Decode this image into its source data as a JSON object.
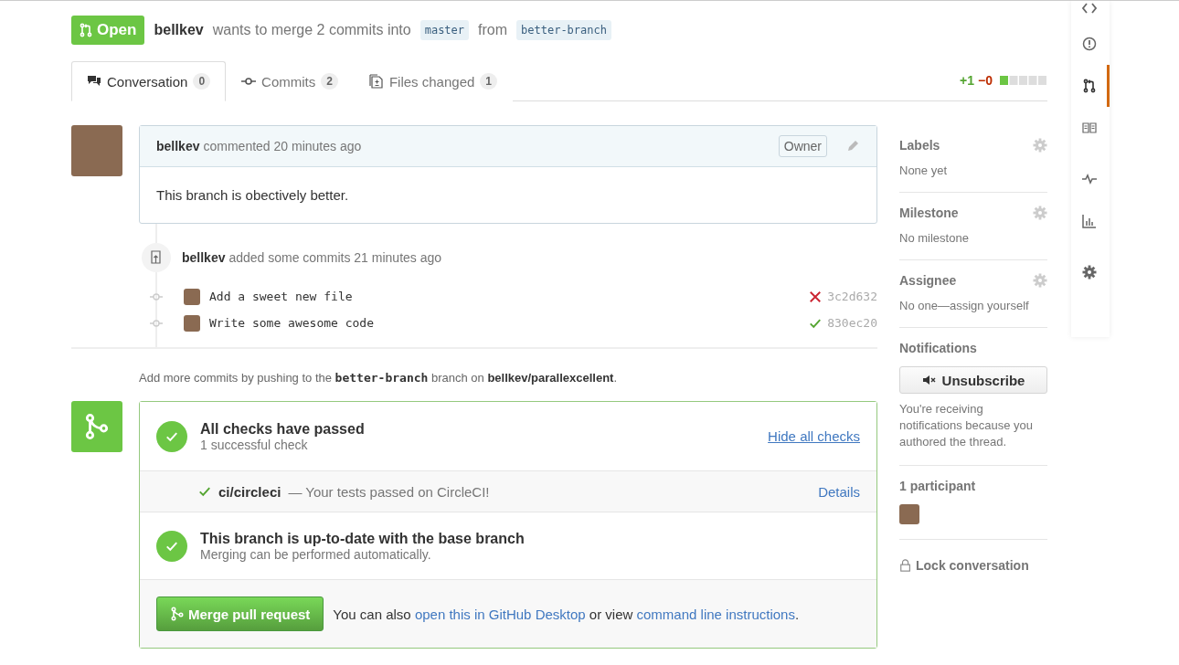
{
  "pr": {
    "state": "Open",
    "author": "bellkev",
    "text": "wants to merge 2 commits into",
    "base": "master",
    "joiner": "from",
    "head": "better-branch"
  },
  "tabs": [
    {
      "kind": "conversation",
      "label": "Conversation",
      "count": "0",
      "selected": true
    },
    {
      "kind": "commits",
      "label": "Commits",
      "count": "2",
      "selected": false
    },
    {
      "kind": "files",
      "label": "Files changed",
      "count": "1",
      "selected": false
    }
  ],
  "diffstat": {
    "added": "+1",
    "removed": "−0"
  },
  "comment": {
    "author": "bellkev",
    "action": "commented 20 minutes ago",
    "role": "Owner",
    "body": "This branch is obectively better."
  },
  "commit_event": {
    "author": "bellkev",
    "action": "added some commits 21 minutes ago",
    "commits": [
      {
        "message": "Add a sweet new file",
        "sha": "3c2d632",
        "passed": false
      },
      {
        "message": "Write some awesome code",
        "sha": "830ec20",
        "passed": true
      }
    ]
  },
  "hint": "Add more commits by pushing to the **better-branch** branch on **bellkev/parallexcellent**.",
  "merge": {
    "checks_title": "All checks have passed",
    "checks_subtitle": "1 successful check",
    "toggle_link": "Hide all checks",
    "checks": [
      {
        "name": "ci/circleci",
        "description": "— Your tests passed on CircleCI!",
        "link": "Details",
        "passed": true
      }
    ],
    "branch_title": "This branch is up-to-date with the base branch",
    "branch_subtitle": "Merging can be performed automatically.",
    "button": "Merge pull request",
    "also": [
      "You can also ",
      "open this in GitHub Desktop",
      " or view ",
      "command line instructions",
      "."
    ]
  },
  "sidebar": {
    "sections": [
      {
        "title": "Labels",
        "value": "None yet"
      },
      {
        "title": "Milestone",
        "value": "No milestone"
      },
      {
        "title": "Assignee",
        "value": "No one—assign yourself"
      }
    ],
    "notifications": {
      "title": "Notifications",
      "button": "Unsubscribe",
      "note": "You're receiving notifications because you authored the thread."
    },
    "participants": {
      "title": "1 participant"
    },
    "lock": "Lock conversation"
  },
  "nav": [
    {
      "kind": "code",
      "selected": false
    },
    {
      "kind": "issues",
      "selected": false
    },
    {
      "kind": "pulls",
      "selected": true
    },
    {
      "kind": "wiki",
      "selected": false
    },
    {
      "kind": "pulse",
      "selected": false
    },
    {
      "kind": "graphs",
      "selected": false
    },
    {
      "kind": "settings",
      "selected": false
    }
  ]
}
